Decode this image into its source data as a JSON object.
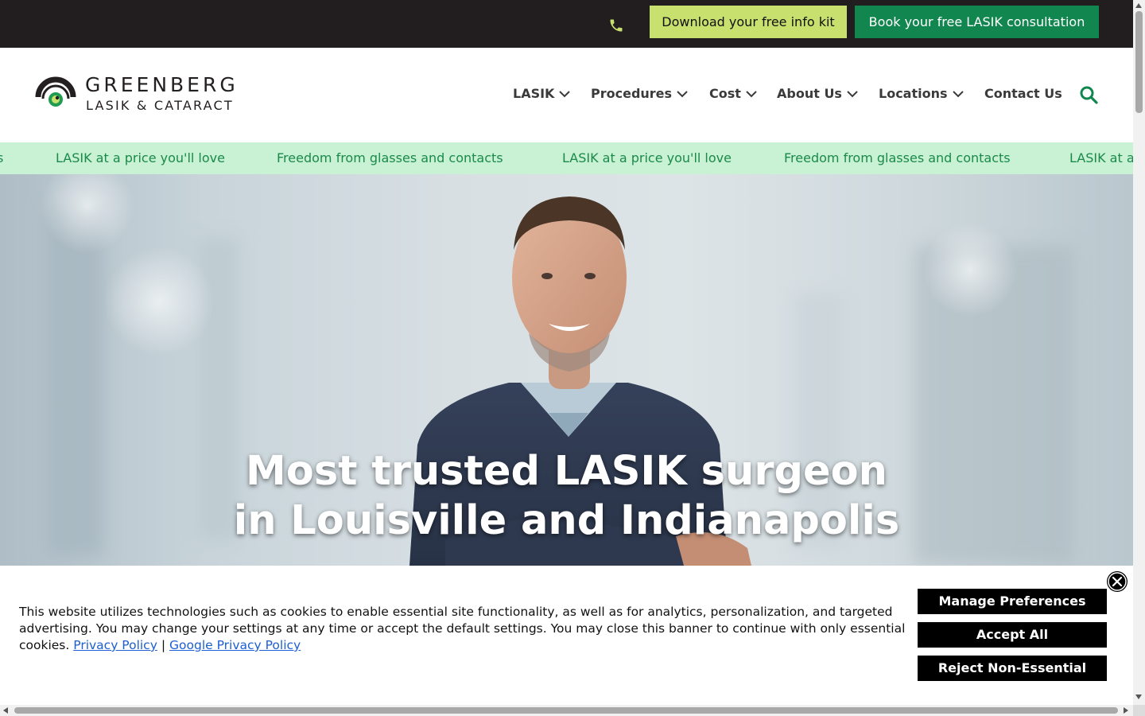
{
  "topbar": {
    "phone_icon": "phone-icon",
    "info_kit_label": "Download your free info kit",
    "book_label": "Book your free LASIK consultation"
  },
  "logo": {
    "line1": "GREENBERG",
    "line2": "LASIK & CATARACT"
  },
  "nav": {
    "items": [
      {
        "label": "LASIK",
        "has_dropdown": true
      },
      {
        "label": "Procedures",
        "has_dropdown": true
      },
      {
        "label": "Cost",
        "has_dropdown": true
      },
      {
        "label": "About Us",
        "has_dropdown": true
      },
      {
        "label": "Locations",
        "has_dropdown": true
      },
      {
        "label": "Contact Us",
        "has_dropdown": false
      }
    ],
    "search_icon": "search-icon"
  },
  "ticker": {
    "items": [
      "s",
      "LASIK at a price you'll love",
      "Freedom from glasses and contacts",
      "LASIK at a price you'll love",
      "Freedom from glasses and contacts",
      "LASIK at a"
    ]
  },
  "hero": {
    "title_line1": "Most trusted LASIK surgeon",
    "title_line2": "in Louisville and Indianapolis"
  },
  "cookie": {
    "text": "This website utilizes technologies such as cookies to enable essential site functionality, as well as for analytics, personalization, and targeted advertising. You may change your settings at any time or accept the default settings. You may close this banner to continue with only essential cookies.",
    "privacy_link": "Privacy Policy",
    "separator": "|",
    "google_link": "Google Privacy Policy",
    "manage_label": "Manage Preferences",
    "accept_label": "Accept All",
    "reject_label": "Reject Non-Essential",
    "close_icon": "close-icon"
  },
  "colors": {
    "topbar_bg": "#221d1f",
    "kit_button": "#c8e06e",
    "book_button": "#12864f",
    "ticker_bg": "#c9f1d4",
    "ticker_text": "#1a8a4b",
    "accent_green": "#12864f"
  }
}
